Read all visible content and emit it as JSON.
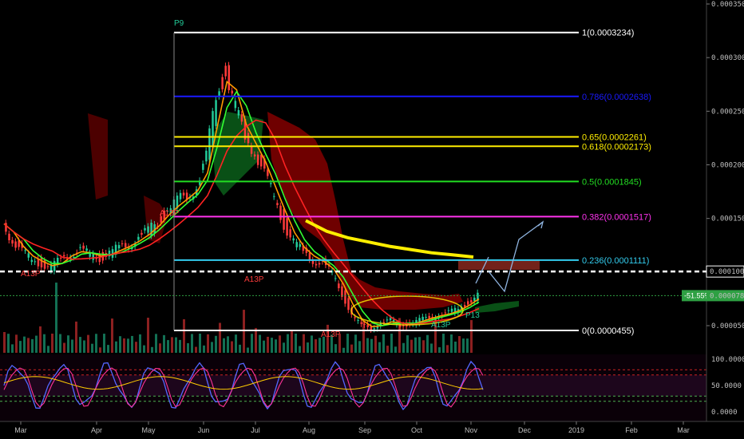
{
  "colors": {
    "background": "#000000",
    "axis_text": "#bfbfbf",
    "fib_white": "#ffffff",
    "fib_blue": "#1a1aff",
    "fib_yellow": "#ffee00",
    "fib_green": "#22dd22",
    "fib_magenta": "#ff33ee",
    "fib_cyan": "#33ccee",
    "down_bar": "#ff3b3b",
    "up_bar": "#22cc99",
    "ema_fast": "#ff9900",
    "ema_mid": "#33ff33",
    "ema_slow": "#ff2222",
    "ma_trend": "#ffee00",
    "cloud_red": "#8b0000",
    "cloud_green": "#0b5e1a",
    "badge_green": "#2ea043",
    "arrow": "#8fb4e0"
  },
  "chart_data": {
    "type": "candlestick",
    "ylim": [
      2e-05,
      0.00035
    ],
    "y_ticks": [
      {
        "value": 0.00035,
        "label": "0.0003500"
      },
      {
        "value": 0.0003,
        "label": "0.0003000"
      },
      {
        "value": 0.00025,
        "label": "0.0002500"
      },
      {
        "value": 0.0002,
        "label": "0.0002000"
      },
      {
        "value": 0.00015,
        "label": "0.0001500"
      },
      {
        "value": 5e-05,
        "label": "0.0000500"
      }
    ],
    "x_ticks": [
      "Mar",
      "Apr",
      "May",
      "Jun",
      "Jul",
      "Aug",
      "Sep",
      "Oct",
      "Nov",
      "Dec",
      "2019",
      "Feb",
      "Mar"
    ],
    "price_marker": {
      "value": 0.0001005,
      "label": "0.0001005"
    },
    "current_price": {
      "value": 7.8e-05,
      "label": "0.0000780",
      "change_label": "-51.55%"
    },
    "fib_levels": [
      {
        "value": 0.0003234,
        "label": "1(0.0003234)",
        "color": "#ffffff"
      },
      {
        "value": 0.0002638,
        "label": "0.786(0.0002638)",
        "color": "#1a1aff"
      },
      {
        "value": 0.0002261,
        "label": "0.65(0.0002261)",
        "color": "#ffee00"
      },
      {
        "value": 0.0002173,
        "label": "0.618(0.0002173)",
        "color": "#ffee00"
      },
      {
        "value": 0.0001845,
        "label": "0.5(0.0001845)",
        "color": "#22dd22"
      },
      {
        "value": 0.0001517,
        "label": "0.382(0.0001517)",
        "color": "#ff33ee"
      },
      {
        "value": 0.0001111,
        "label": "0.236(0.0001111)",
        "color": "#33ccee"
      },
      {
        "value": 4.55e-05,
        "label": "0(0.0000455)",
        "color": "#ffffff"
      }
    ],
    "close_series": [
      0.000145,
      0.00013,
      0.000118,
      0.000112,
      0.000108,
      0.000104,
      0.000112,
      0.000118,
      0.00012,
      0.000116,
      0.000114,
      0.000118,
      0.000122,
      0.000126,
      0.000132,
      0.000138,
      0.000148,
      0.000158,
      0.000165,
      0.000172,
      0.00018,
      0.000205,
      0.000265,
      0.00029,
      0.00025,
      0.000225,
      0.000215,
      0.00019,
      0.00017,
      0.000145,
      0.000128,
      0.000118,
      0.000112,
      0.000108,
      9.8e-05,
      8e-05,
      6e-05,
      5e-05,
      4.8e-05,
      5.2e-05,
      5.5e-05,
      5e-05,
      5.2e-05,
      5.5e-05,
      5.8e-05,
      6e-05,
      6.2e-05,
      6.6e-05,
      7.2e-05,
      7.8e-05
    ],
    "ma_trend_series": [
      0.000148,
      0.000138,
      0.000132,
      0.000128,
      0.000124,
      0.000121,
      0.000118,
      0.000116,
      0.000114
    ],
    "labels": [
      {
        "text": "P9",
        "value": 0.000334,
        "color": "#22cc99"
      },
      {
        "text": "A13P",
        "value": 8.9e-05,
        "color": "#ff3b3b"
      },
      {
        "text": "A13P",
        "value": 9.2e-05,
        "color": "#ff3b3b"
      },
      {
        "text": "A13P",
        "value": 3.8e-05,
        "color": "#ff3b3b"
      },
      {
        "text": "A13P",
        "value": 4.4e-05,
        "color": "#22cc99"
      },
      {
        "text": "A13P",
        "value": 0.000162,
        "color": "#ff3b3b"
      },
      {
        "text": "P13",
        "value": 5.6e-05,
        "color": "#22cc99"
      }
    ],
    "rsi": {
      "ylim": [
        0,
        100
      ],
      "y_ticks": [
        {
          "value": 100,
          "label": "100.0000"
        },
        {
          "value": 50,
          "label": "50.0000"
        },
        {
          "value": 0,
          "label": "0.0000"
        }
      ],
      "levels": [
        80,
        70,
        30,
        20
      ]
    }
  }
}
